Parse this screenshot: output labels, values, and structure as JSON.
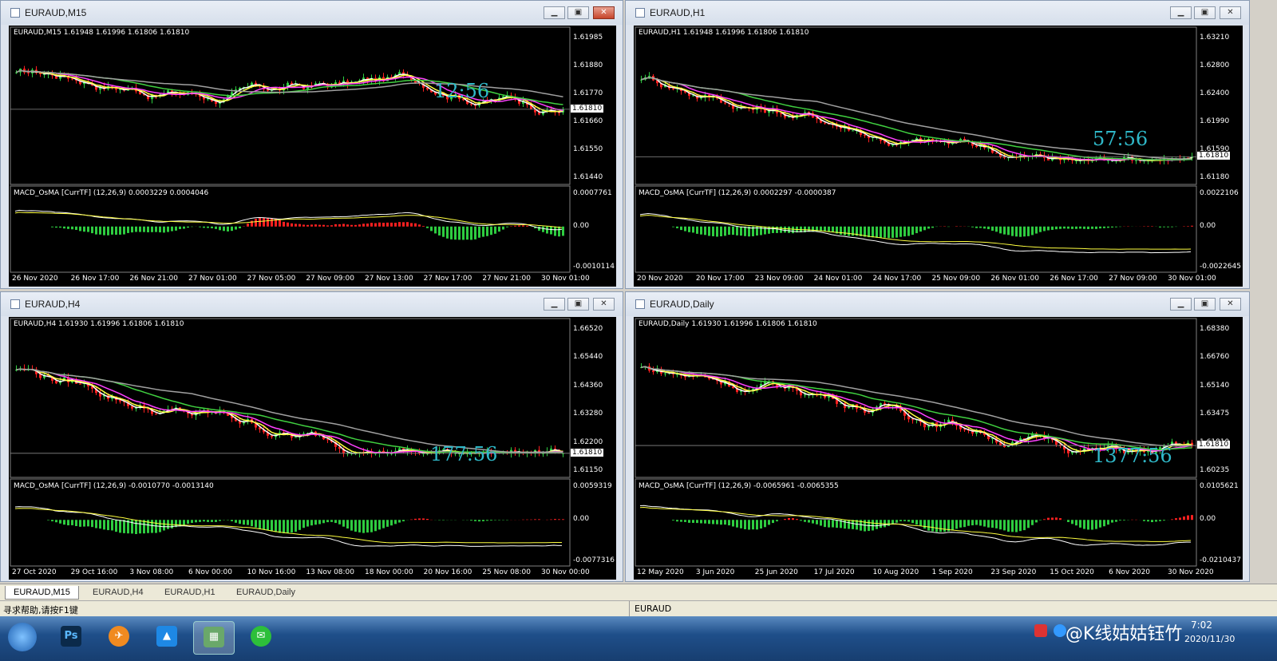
{
  "windows": [
    {
      "title": "EURAUD,M15",
      "info": "EURAUD,M15  1.61948 1.61996 1.61806 1.61810",
      "price_ticks": [
        "1.61985",
        "1.61880",
        "1.61770",
        "1.61660",
        "1.61550",
        "1.61440"
      ],
      "current_price": "1.61810",
      "countdown": "12:56",
      "macd_label": "MACD_OsMA [CurrTF] (12,26,9) 0.0003229 0.0004046",
      "macd_ticks": [
        "0.0007761",
        "0.00",
        "-0.0010114"
      ],
      "time_ticks": [
        "26 Nov 2020",
        "26 Nov 17:00",
        "26 Nov 21:00",
        "27 Nov 01:00",
        "27 Nov 05:00",
        "27 Nov 09:00",
        "27 Nov 13:00",
        "27 Nov 17:00",
        "27 Nov 21:00",
        "30 Nov 01:00"
      ]
    },
    {
      "title": "EURAUD,H1",
      "info": "EURAUD,H1  1.61948 1.61996 1.61806 1.61810",
      "price_ticks": [
        "1.63210",
        "1.62800",
        "1.62400",
        "1.61990",
        "1.61590",
        "1.61180"
      ],
      "current_price": "1.61810",
      "countdown": "57:56",
      "macd_label": "MACD_OsMA [CurrTF] (12,26,9) 0.0002297 -0.0000387",
      "macd_ticks": [
        "0.0022106",
        "0.00",
        "-0.0022645"
      ],
      "time_ticks": [
        "20 Nov 2020",
        "20 Nov 17:00",
        "23 Nov 09:00",
        "24 Nov 01:00",
        "24 Nov 17:00",
        "25 Nov 09:00",
        "26 Nov 01:00",
        "26 Nov 17:00",
        "27 Nov 09:00",
        "30 Nov 01:00"
      ]
    },
    {
      "title": "EURAUD,H4",
      "info": "EURAUD,H4  1.61930 1.61996 1.61806 1.61810",
      "price_ticks": [
        "1.66520",
        "1.65440",
        "1.64360",
        "1.63280",
        "1.62200",
        "1.61150"
      ],
      "current_price": "1.61810",
      "countdown": "177:56",
      "macd_label": "MACD_OsMA [CurrTF] (12,26,9) -0.0010770 -0.0013140",
      "macd_ticks": [
        "0.0059319",
        "0.00",
        "-0.0077316"
      ],
      "time_ticks": [
        "27 Oct 2020",
        "29 Oct 16:00",
        "3 Nov 08:00",
        "6 Nov 00:00",
        "10 Nov 16:00",
        "13 Nov 08:00",
        "18 Nov 00:00",
        "20 Nov 16:00",
        "25 Nov 08:00",
        "30 Nov 00:00"
      ]
    },
    {
      "title": "EURAUD,Daily",
      "info": "EURAUD,Daily  1.61930 1.61996 1.61806 1.61810",
      "price_ticks": [
        "1.68380",
        "1.66760",
        "1.65140",
        "1.63475",
        "1.61810",
        "1.60235"
      ],
      "current_price": "1.61810",
      "countdown": "1377:56",
      "macd_label": "MACD_OsMA [CurrTF] (12,26,9) -0.0065961 -0.0065355",
      "macd_ticks": [
        "0.0105621",
        "0.00",
        "-0.0210437"
      ],
      "time_ticks": [
        "12 May 2020",
        "3 Jun 2020",
        "25 Jun 2020",
        "17 Jul 2020",
        "10 Aug 2020",
        "1 Sep 2020",
        "23 Sep 2020",
        "15 Oct 2020",
        "6 Nov 2020",
        "30 Nov 2020"
      ]
    }
  ],
  "tabs": [
    "EURAUD,M15",
    "EURAUD,H4",
    "EURAUD,H1",
    "EURAUD,Daily"
  ],
  "status": {
    "help": "寻求帮助,请按F1键",
    "symbol": "EURAUD"
  },
  "taskbar": {
    "time": "7:02",
    "date": "2020/11/30",
    "watermark": "@K线姑姑钰竹"
  },
  "colors": {
    "bull": "#2ecc40",
    "bear": "#ff2020",
    "ma_white": "#ffffff",
    "ma_yellow": "#ffff40",
    "ma_magenta": "#ff40ff",
    "ma_green": "#40d040",
    "ma_gray": "#a0a0a0",
    "countdown": "#2fb8c8"
  }
}
